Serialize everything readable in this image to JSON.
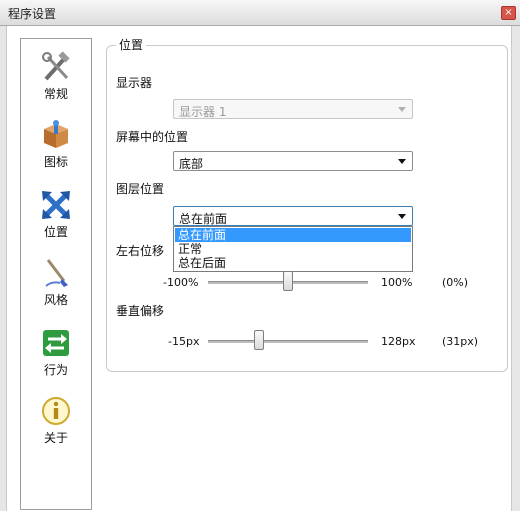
{
  "window": {
    "title": "程序设置",
    "close_glyph": "×"
  },
  "sidebar": {
    "items": [
      {
        "label": "常规",
        "icon": "tools-icon"
      },
      {
        "label": "图标",
        "icon": "package-icon"
      },
      {
        "label": "位置",
        "icon": "move-arrows-icon"
      },
      {
        "label": "风格",
        "icon": "brush-icon"
      },
      {
        "label": "行为",
        "icon": "arrows-icon"
      },
      {
        "label": "关于",
        "icon": "info-icon"
      }
    ]
  },
  "group": {
    "title": "位置"
  },
  "display": {
    "label": "显示器",
    "value": "显示器 1"
  },
  "screen_position": {
    "label": "屏幕中的位置",
    "value": "底部"
  },
  "layer_position": {
    "label": "图层位置",
    "value": "总在前面",
    "options": [
      "总在前面",
      "正常",
      "总在后面"
    ],
    "selected_index": 0
  },
  "horizontal_offset": {
    "label": "左右位移",
    "min_label": "-100%",
    "max_label": "100%",
    "value_label": "(0%)",
    "value": 0,
    "min": -100,
    "max": 100
  },
  "vertical_offset": {
    "label": "垂直偏移",
    "min_label": "-15px",
    "max_label": "128px",
    "value_label": "(31px)",
    "value": 31,
    "min": -15,
    "max": 128
  },
  "colors": {
    "selection": "#3399ff",
    "close_button": "#d6564b"
  }
}
